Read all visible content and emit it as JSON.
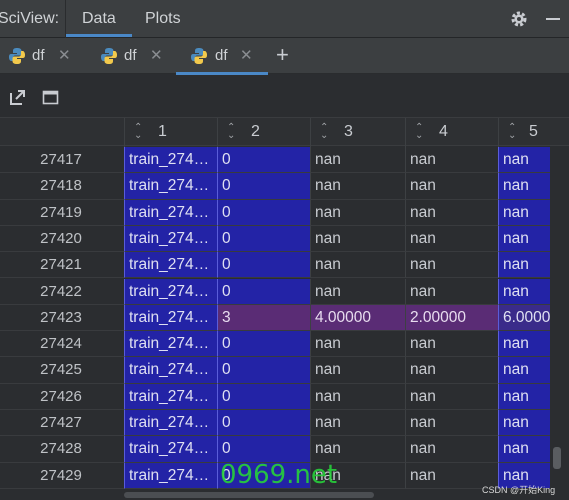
{
  "titlebar": {
    "app_title": "SciView:",
    "tabs": [
      "Data",
      "Plots"
    ]
  },
  "df_tabs": [
    {
      "label": "df",
      "active": false
    },
    {
      "label": "df",
      "active": false
    },
    {
      "label": "df",
      "active": true
    }
  ],
  "table": {
    "headers": [
      "1",
      "2",
      "3",
      "4",
      "5"
    ],
    "rows": [
      {
        "index": "27417",
        "cells": [
          "train_274…",
          "0",
          "nan",
          "nan",
          "nan"
        ]
      },
      {
        "index": "27418",
        "cells": [
          "train_274…",
          "0",
          "nan",
          "nan",
          "nan"
        ]
      },
      {
        "index": "27419",
        "cells": [
          "train_274…",
          "0",
          "nan",
          "nan",
          "nan"
        ]
      },
      {
        "index": "27420",
        "cells": [
          "train_274…",
          "0",
          "nan",
          "nan",
          "nan"
        ]
      },
      {
        "index": "27421",
        "cells": [
          "train_274…",
          "0",
          "nan",
          "nan",
          "nan"
        ]
      },
      {
        "index": "27422",
        "cells": [
          "train_274…",
          "0",
          "nan",
          "nan",
          "nan"
        ]
      },
      {
        "index": "27423",
        "cells": [
          "train_274…",
          "3",
          "4.00000",
          "2.00000",
          "6.0000"
        ]
      },
      {
        "index": "27424",
        "cells": [
          "train_274…",
          "0",
          "nan",
          "nan",
          "nan"
        ]
      },
      {
        "index": "27425",
        "cells": [
          "train_274…",
          "0",
          "nan",
          "nan",
          "nan"
        ]
      },
      {
        "index": "27426",
        "cells": [
          "train_274…",
          "0",
          "nan",
          "nan",
          "nan"
        ]
      },
      {
        "index": "27427",
        "cells": [
          "train_274…",
          "0",
          "nan",
          "nan",
          "nan"
        ]
      },
      {
        "index": "27428",
        "cells": [
          "train_274…",
          "0",
          "nan",
          "nan",
          "nan"
        ]
      },
      {
        "index": "27429",
        "cells": [
          "train_274…",
          "0",
          "nan",
          "nan",
          "nan"
        ]
      }
    ]
  },
  "watermark": {
    "big": "0969.net",
    "small": "CSDN @开始King"
  },
  "colors": {
    "accent": "#4a88c7",
    "selected_cell": "#2323a6",
    "highlight_row": "#5a2c75"
  }
}
